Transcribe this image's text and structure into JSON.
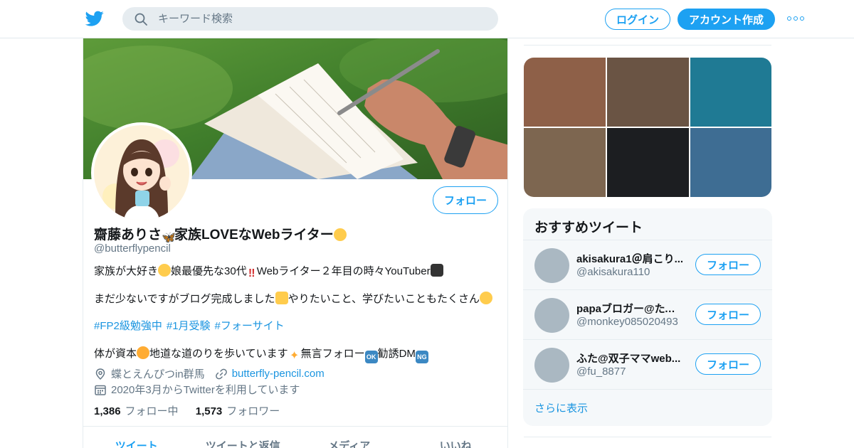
{
  "nav": {
    "logo_icon": "twitter-bird-icon",
    "search_placeholder": "キーワード検索",
    "login_label": "ログイン",
    "signup_label": "アカウント作成",
    "more_icon": "more-dots-icon",
    "accent_color": "#1da1f2"
  },
  "profile": {
    "name": "齋藤ありさ",
    "name_part2": "家族LOVEなWebライター",
    "handle": "@butterflypencil",
    "follow_label": "フォロー",
    "bio": {
      "l1_a": "家族が大好き",
      "l1_b": "娘最優先な30代",
      "l1_c": "Webライター２年目の時々YouTuber",
      "l2_a": "まだ少ないですがブログ完成しました",
      "l2_b": "やりたいこと、学びたいこともたくさん",
      "tags": [
        "#FP2級勉強中",
        "#1月受験",
        "#フォーサイト"
      ],
      "l4_a": "体が資本",
      "l4_b": "地道な道のりを歩いています",
      "l4_c": "無言フォロー",
      "l4_ok": "OK",
      "l4_d": "勧誘DM",
      "l4_ng": "NG"
    },
    "location": "蝶とえんぴつin群馬",
    "url": "butterfly-pencil.com",
    "joined": "2020年3月からTwitterを利用しています",
    "following_count": "1,386",
    "following_label": "フォロー中",
    "followers_count": "1,573",
    "followers_label": "フォロワー"
  },
  "tabs": [
    "ツイート",
    "ツイートと返信",
    "メディア",
    "いいね"
  ],
  "media_colors": [
    "#8e6048",
    "#6a5444",
    "#1f7a94",
    "#7d6650",
    "#1c1e21",
    "#3e6d93"
  ],
  "recommend": {
    "title": "おすすめツイート",
    "users": [
      {
        "name": "akisakura1＠肩こり...",
        "handle": "@akisakura110",
        "button": "フォロー"
      },
      {
        "name": "papaブロガー@たろ吉",
        "handle": "@monkey085020493",
        "button": "フォロー"
      },
      {
        "name": "ふた@双子ママweb...",
        "handle": "@fu_8877",
        "button": "フォロー"
      }
    ],
    "show_more": "さらに表示"
  }
}
